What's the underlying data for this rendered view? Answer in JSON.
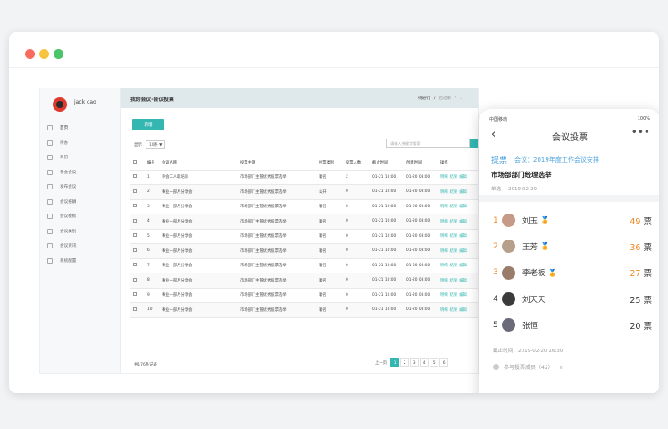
{
  "colors": {
    "accent": "#35b7b1",
    "blue": "#4da2dd",
    "orange": "#f08a24"
  },
  "window": {
    "dots": [
      "#f76c5e",
      "#f7c440",
      "#4cc46a"
    ]
  },
  "app": {
    "user_name": "jack cao",
    "title": "我的会议-会议投票",
    "steps": [
      "待进行",
      "已结束",
      "..."
    ],
    "nav": [
      "首页",
      "待办",
      "日历",
      "参会会议",
      "发布会议",
      "会议报酬",
      "会议模板",
      "会议类别",
      "会议资讯",
      "系统配置"
    ],
    "new_button": "新增",
    "show_label": "显示",
    "show_value": "10条 ▼",
    "search_placeholder": "请输入关键字搜索",
    "columns": [
      "",
      "编号",
      "会议名称",
      "投票主题",
      "投票类别",
      "投票人数",
      "截止时间",
      "创建时间",
      "操作"
    ],
    "rows": [
      [
        "1",
        "参会工人职培训",
        "市场部门主管优秀投票选举",
        "署名",
        "2",
        "01-21 10:00",
        "01-20 08:00"
      ],
      [
        "2",
        "事业一部月分享会",
        "市场部门主管优秀投票选举",
        "公开",
        "0",
        "01-21 10:00",
        "01-20 08:00"
      ],
      [
        "3",
        "事业一部月分享会",
        "市场部门主管优秀投票选举",
        "署名",
        "0",
        "01-21 10:00",
        "01-20 08:00"
      ],
      [
        "4",
        "事业一部月分享会",
        "市场部门主管优秀投票选举",
        "署名",
        "0",
        "01-21 10:00",
        "01-20 08:00"
      ],
      [
        "5",
        "事业一部月分享会",
        "市场部门主管优秀投票选举",
        "署名",
        "0",
        "01-21 10:00",
        "01-20 08:00"
      ],
      [
        "6",
        "事业一部月分享会",
        "市场部门主管优秀投票选举",
        "署名",
        "0",
        "01-21 10:00",
        "01-20 08:00"
      ],
      [
        "7",
        "事业一部月分享会",
        "市场部门主管优秀投票选举",
        "署名",
        "0",
        "01-21 10:00",
        "01-20 08:00"
      ],
      [
        "8",
        "事业一部月分享会",
        "市场部门主管优秀投票选举",
        "署名",
        "0",
        "01-21 10:00",
        "01-20 08:00"
      ],
      [
        "9",
        "事业一部月分享会",
        "市场部门主管优秀投票选举",
        "署名",
        "0",
        "01-21 10:00",
        "01-20 08:00"
      ],
      [
        "10",
        "事业一部月分享会",
        "市场部门主管优秀投票选举",
        "署名",
        "0",
        "01-21 10:00",
        "01-20 08:00"
      ]
    ],
    "row_ops": [
      "明细",
      "结果",
      "编辑"
    ],
    "total": "共176条记录",
    "pager_prev": "上一页",
    "pages": [
      "1",
      "2",
      "3",
      "4",
      "5",
      "6"
    ],
    "current_page": "1"
  },
  "phone": {
    "carrier": "中国移动",
    "battery": "100%",
    "title": "会议投票",
    "back": "‹",
    "more": "•••",
    "tag": "提票",
    "meeting": "会议：2019年度工作会议安排",
    "subject": "市场部部门经理选举",
    "poll_type": "单选",
    "poll_date": "2019-02-20",
    "ranking": [
      {
        "rank": "1",
        "name": "刘玉",
        "votes": "49",
        "unit": "票",
        "medal": true,
        "color": "#f08a24"
      },
      {
        "rank": "2",
        "name": "王芳",
        "votes": "36",
        "unit": "票",
        "medal": true,
        "color": "#f08a24"
      },
      {
        "rank": "3",
        "name": "李老板",
        "votes": "27",
        "unit": "票",
        "medal": true,
        "color": "#f08a24"
      },
      {
        "rank": "4",
        "name": "刘天天",
        "votes": "25",
        "unit": "票",
        "medal": false,
        "color": "#333333"
      },
      {
        "rank": "5",
        "name": "张恒",
        "votes": "20",
        "unit": "票",
        "medal": false,
        "color": "#333333"
      }
    ],
    "medal_icon": "🏅",
    "deadline": "截止时间：2019-02-20 16:30",
    "participants": "参与投票成员（42）",
    "avatar_colors": [
      "#c69a86",
      "#b7a089",
      "#9a7c6a",
      "#3b3b3b",
      "#6a6a7a"
    ]
  }
}
